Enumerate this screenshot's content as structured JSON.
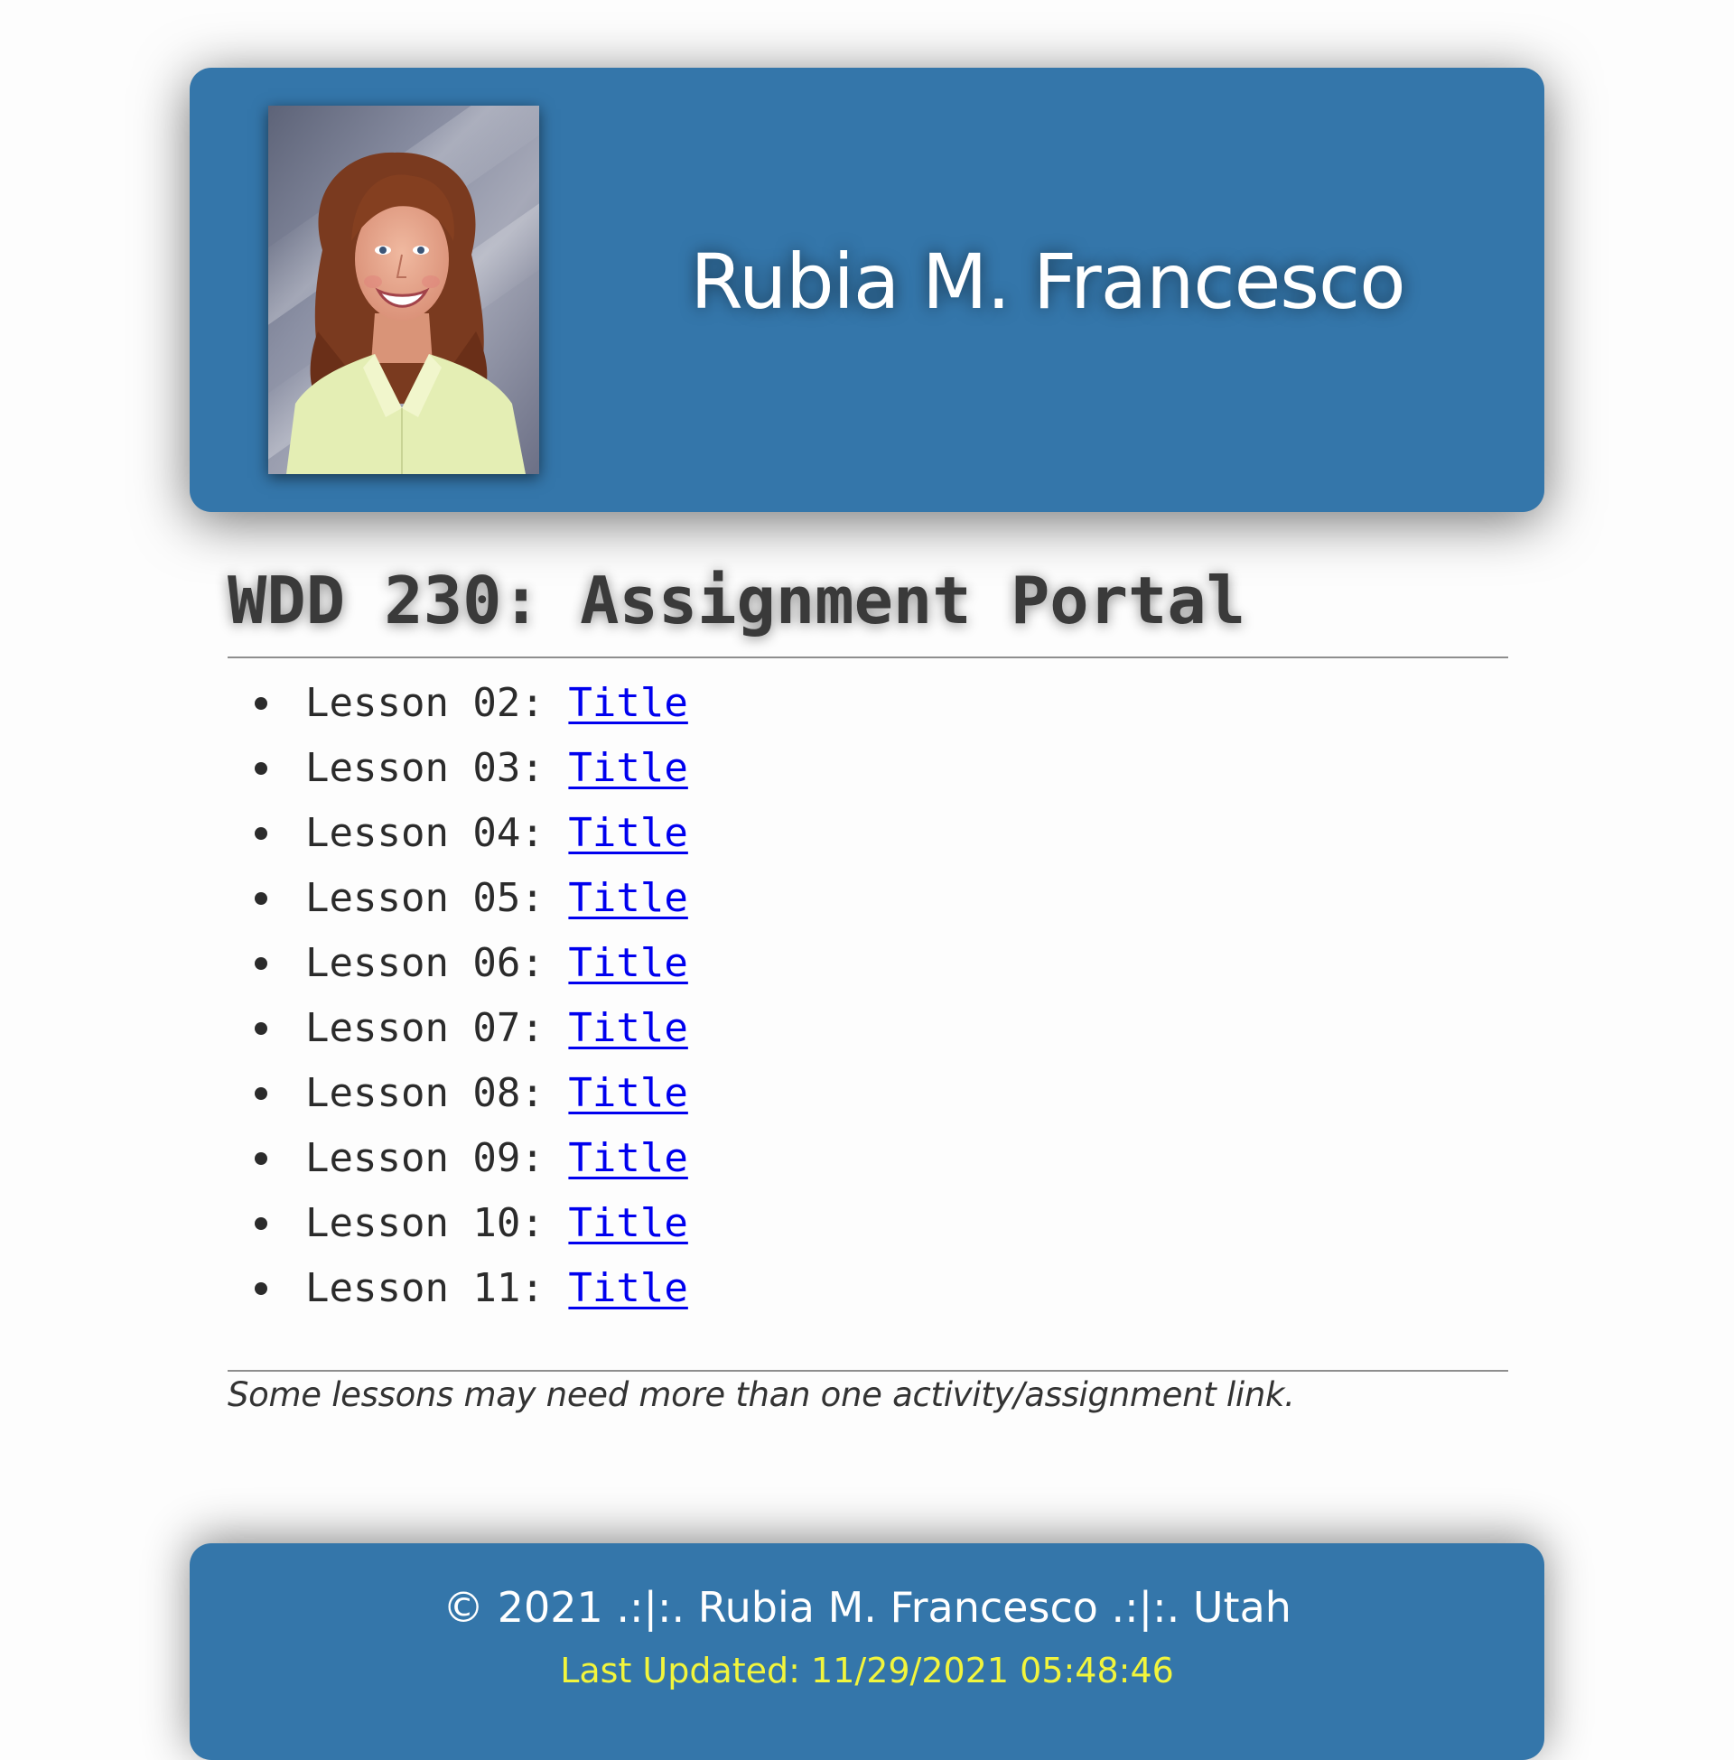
{
  "header": {
    "name": "Rubia M. Francesco",
    "photo_alt": "Portrait of Rubia M. Francesco",
    "background_color": "#3476aa"
  },
  "main": {
    "title": "WDD 230: Assignment Portal",
    "lessons": [
      {
        "label": "Lesson 02: ",
        "link": "Title"
      },
      {
        "label": "Lesson 03: ",
        "link": "Title"
      },
      {
        "label": "Lesson 04: ",
        "link": "Title"
      },
      {
        "label": "Lesson 05: ",
        "link": "Title"
      },
      {
        "label": "Lesson 06: ",
        "link": "Title"
      },
      {
        "label": "Lesson 07: ",
        "link": "Title"
      },
      {
        "label": "Lesson 08: ",
        "link": "Title"
      },
      {
        "label": "Lesson 09: ",
        "link": "Title"
      },
      {
        "label": "Lesson 10: ",
        "link": "Title"
      },
      {
        "label": "Lesson 11: ",
        "link": "Title"
      }
    ],
    "note": "Some lessons may need more than one activity/assignment link."
  },
  "footer": {
    "copyright": "© 2021 .:|:. Rubia M. Francesco .:|:. Utah",
    "last_updated": "Last Updated: 11/29/2021 05:48:46",
    "updated_color": "#f2f53c"
  }
}
